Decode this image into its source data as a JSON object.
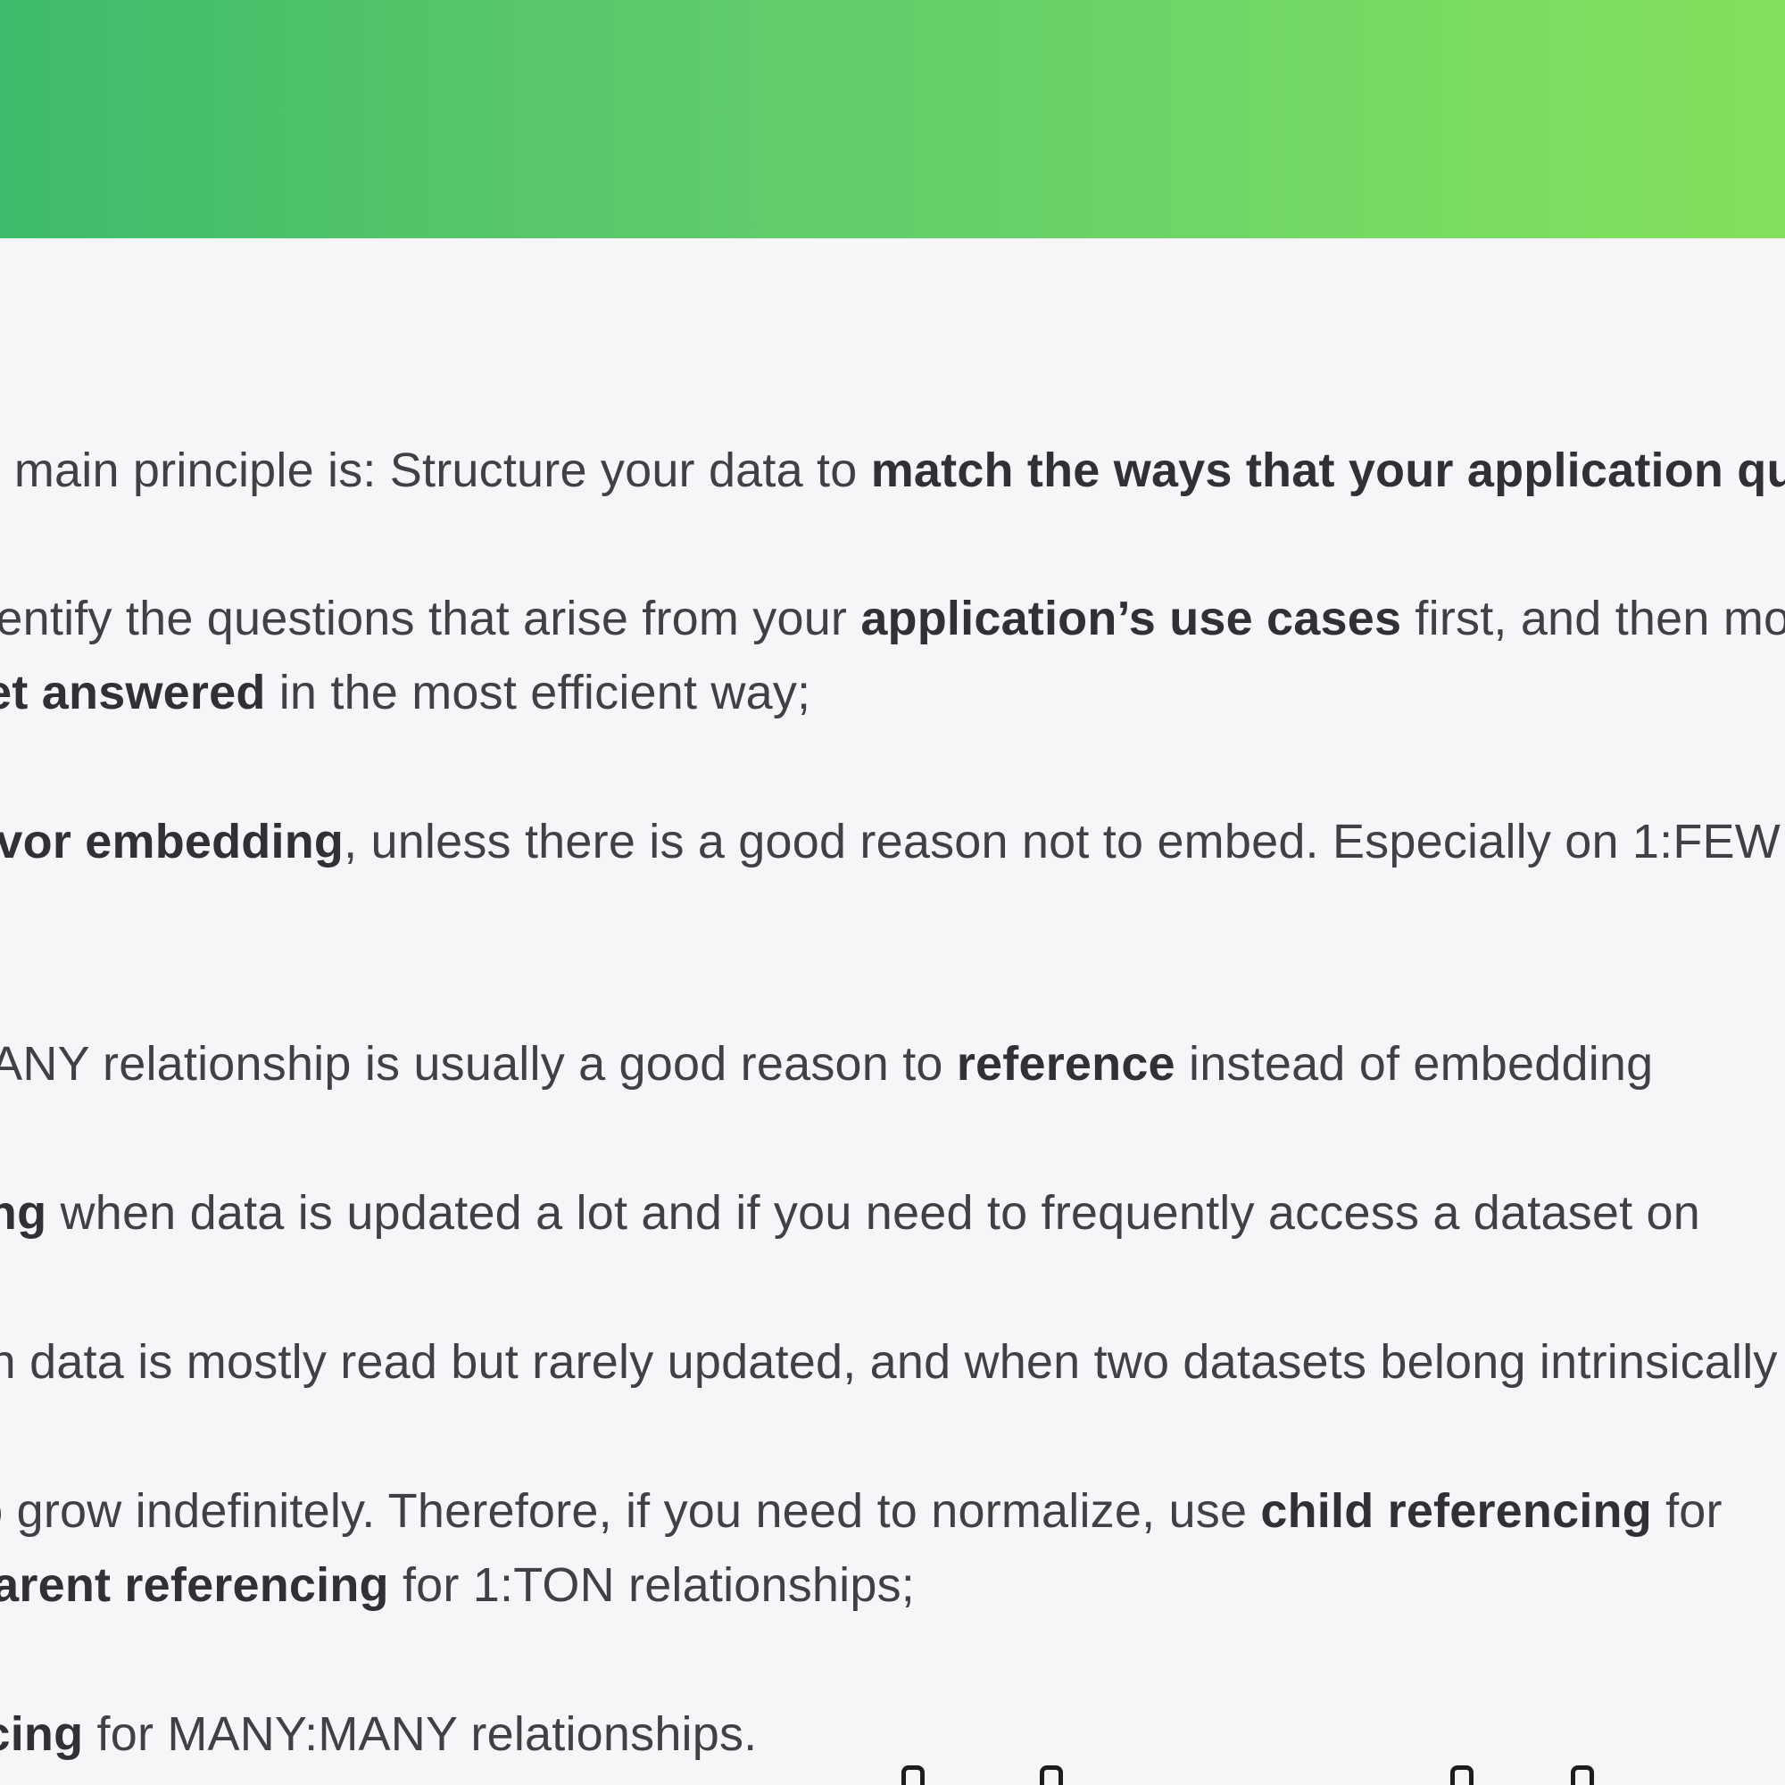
{
  "lines": [
    {
      "text_1": "The main principle is: Structure your data to ",
      "bold_1": "match the ways that your application queries",
      "text_2": ""
    },
    {
      "text_1": "Identify the questions that arise from your ",
      "bold_1": "application’s use cases",
      "text_2": " first, and then model"
    },
    {
      "bold_1": "get answered",
      "text_1": " in the most efficient way;"
    },
    {
      "bold_1": "favor embedding",
      "text_1": ", unless there is a good reason not to embed. Especially on 1:FEW"
    },
    {
      "text_1": "MANY relationship is usually a good reason to ",
      "bold_1": "reference",
      "text_2": " instead of embedding"
    },
    {
      "bold_1": "referencing",
      "text_1": " when data is updated a lot and if you need to frequently access a dataset on"
    },
    {
      "text_1": "when data is mostly read but rarely updated, and when two datasets belong intrinsically"
    },
    {
      "text_1": "to grow indefinitely. Therefore, if you need to normalize, use ",
      "bold_1": "child referencing",
      "text_2": " for"
    },
    {
      "bold_1": "parent referencing",
      "text_1": " for 1:TON relationships;"
    },
    {
      "bold_1": "referencing",
      "text_1": " for MANY:MANY relationships."
    }
  ]
}
